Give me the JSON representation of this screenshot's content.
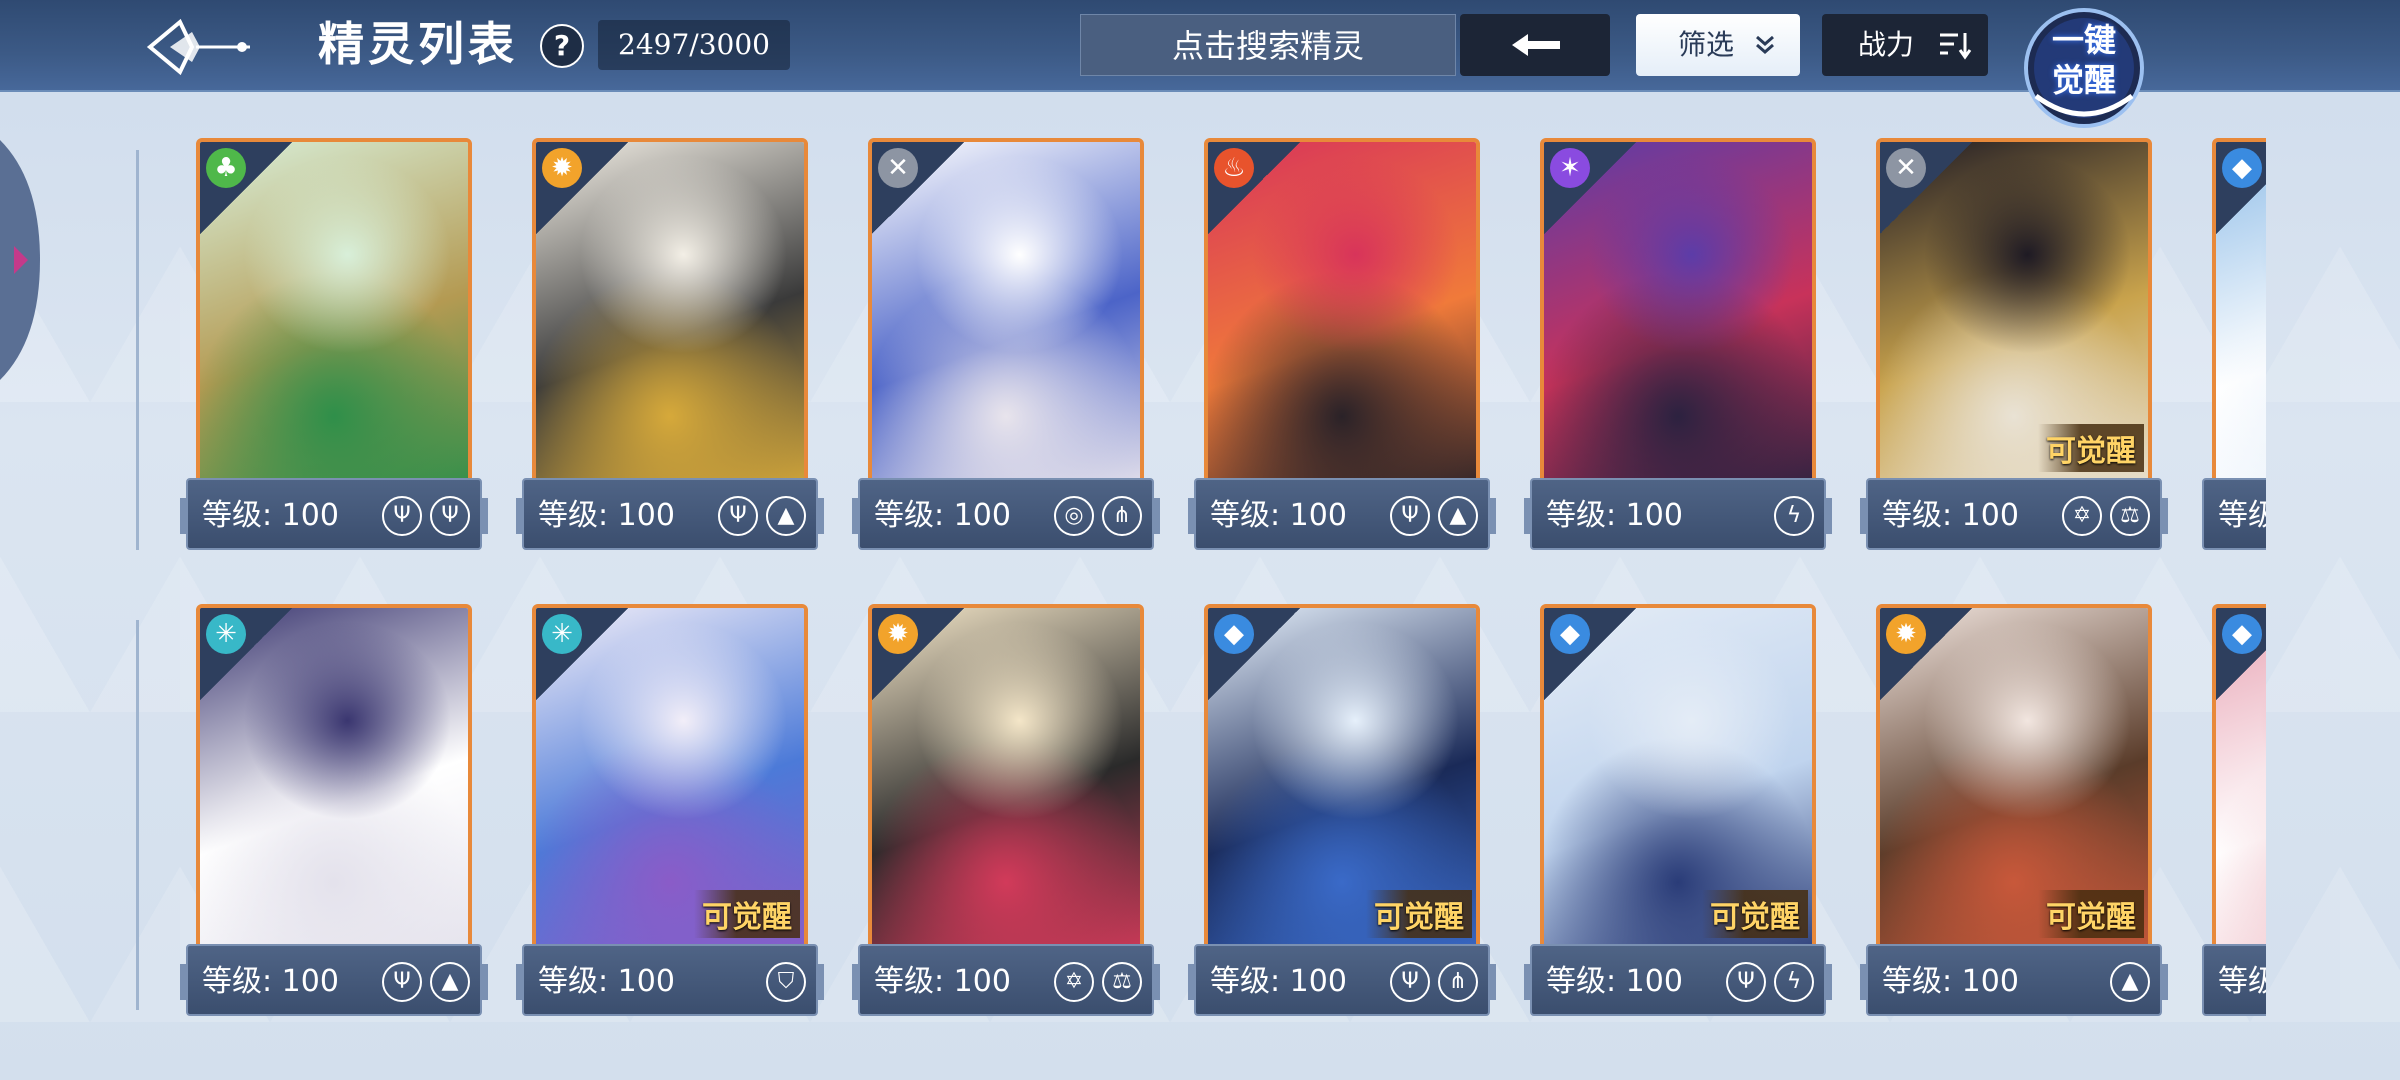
{
  "header": {
    "title": "精灵列表",
    "help_icon": "?",
    "count": "2497/3000",
    "search_placeholder": "点击搜索精灵",
    "filter_label": "筛选",
    "sort_label": "战力",
    "awaken_line1": "一键",
    "awaken_line2": "觉醒"
  },
  "colors": {
    "frame": "#e8893a",
    "plate": "#3b4e6e",
    "awake_text": "#ffd466"
  },
  "cards": [
    {
      "element": "grass",
      "element_color": "#4fb84a",
      "level": "等级: 100",
      "skills": [
        "trident-icon",
        "trident-icon"
      ],
      "awakenable": "",
      "palette": [
        "#2f8f4a",
        "#d8efd9",
        "#b49a52"
      ]
    },
    {
      "element": "light",
      "element_color": "#f2a32b",
      "level": "等级: 100",
      "skills": [
        "trident-icon",
        "book-icon"
      ],
      "awakenable": "",
      "palette": [
        "#d6a93a",
        "#f3efe6",
        "#3a3a3a"
      ]
    },
    {
      "element": "neutral",
      "element_color": "#8d95a3",
      "level": "等级: 100",
      "skills": [
        "swirl-icon",
        "claw-icon"
      ],
      "awakenable": "",
      "palette": [
        "#e8e4ec",
        "#ffffff",
        "#4c64c8"
      ]
    },
    {
      "element": "fire",
      "element_color": "#e8532c",
      "level": "等级: 100",
      "skills": [
        "trident-icon",
        "book-icon"
      ],
      "awakenable": "",
      "palette": [
        "#2a2228",
        "#d8345a",
        "#f07a3a"
      ]
    },
    {
      "element": "shadow",
      "element_color": "#8a4be0",
      "level": "等级: 100",
      "skills": [
        "lightning-icon"
      ],
      "awakenable": "",
      "palette": [
        "#2c2240",
        "#5c3ca8",
        "#c8325a"
      ]
    },
    {
      "element": "neutral",
      "element_color": "#8d95a3",
      "level": "等级: 100",
      "skills": [
        "star-icon",
        "scale-icon"
      ],
      "awakenable": "可觉醒",
      "palette": [
        "#e9e2d4",
        "#1e1a24",
        "#c9a34c"
      ]
    },
    {
      "element": "water",
      "element_color": "#3a8be0",
      "level": "等级",
      "skills": [],
      "awakenable": "",
      "palette": [
        "#eaf2fb",
        "#8fbde8",
        "#ffffff"
      ]
    },
    {
      "element": "ice",
      "element_color": "#38b8c8",
      "level": "等级: 100",
      "skills": [
        "trident-icon",
        "book-icon"
      ],
      "awakenable": "",
      "palette": [
        "#e4e2ec",
        "#3a3670",
        "#ffffff"
      ]
    },
    {
      "element": "ice",
      "element_color": "#38b8c8",
      "level": "等级: 100",
      "skills": [
        "shield-icon"
      ],
      "awakenable": "可觉醒",
      "palette": [
        "#8a5cc8",
        "#f2eef8",
        "#4c7ad8"
      ]
    },
    {
      "element": "light",
      "element_color": "#f2a32b",
      "level": "等级: 100",
      "skills": [
        "star-icon",
        "scale-icon"
      ],
      "awakenable": "",
      "palette": [
        "#d23a5a",
        "#f4e6c8",
        "#2a2a2a"
      ]
    },
    {
      "element": "water",
      "element_color": "#3a8be0",
      "level": "等级: 100",
      "skills": [
        "trident-icon",
        "claw-icon"
      ],
      "awakenable": "可觉醒",
      "palette": [
        "#3a6ac8",
        "#e6f0fb",
        "#1a2a58"
      ]
    },
    {
      "element": "water",
      "element_color": "#3a8be0",
      "level": "等级: 100",
      "skills": [
        "trident-icon",
        "lightning-icon"
      ],
      "awakenable": "可觉醒",
      "palette": [
        "#2a3c78",
        "#e4ecf6",
        "#c0d4ee"
      ]
    },
    {
      "element": "light",
      "element_color": "#f2a32b",
      "level": "等级: 100",
      "skills": [
        "book-icon"
      ],
      "awakenable": "可觉醒",
      "palette": [
        "#c8583a",
        "#f2e6e0",
        "#5a3c2a"
      ]
    },
    {
      "element": "water",
      "element_color": "#3a8be0",
      "level": "等级",
      "skills": [],
      "awakenable": "",
      "palette": [
        "#f0c4cc",
        "#e8a4b4",
        "#ffffff"
      ]
    }
  ]
}
